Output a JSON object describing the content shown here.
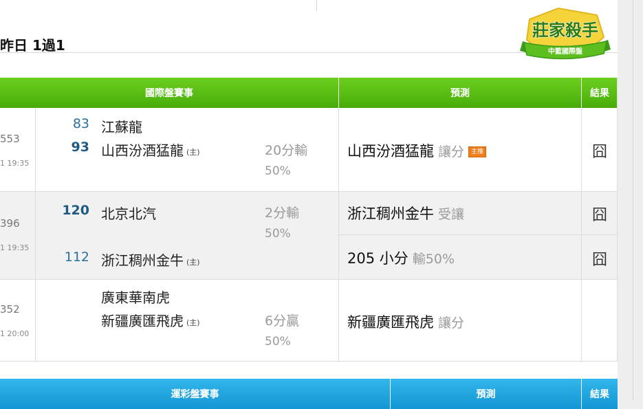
{
  "section_title": "昨日 1過1",
  "logo": {
    "line1": "莊家殺手",
    "line2": "中籃國際盤"
  },
  "intl_table": {
    "headers": {
      "match": "國際盤賽事",
      "prediction": "預測",
      "result": "結果"
    },
    "rows": [
      {
        "game_id": "553",
        "time": "1 19:35",
        "away": {
          "score": "83",
          "team": "江蘇龍"
        },
        "home": {
          "score": "93",
          "team": "山西汾酒猛龍",
          "tag": "(主)"
        },
        "line": "20分輸 50%",
        "predictions": [
          {
            "team": "山西汾酒猛龍",
            "type": "讓分",
            "badge": "主推",
            "result": "囧"
          }
        ]
      },
      {
        "game_id": "396",
        "time": "1 19:35",
        "away": {
          "score": "120",
          "team": "北京北汽"
        },
        "home": {
          "score": "112",
          "team": "浙江稠州金牛",
          "tag": "(主)"
        },
        "line": "2分輸 50%",
        "predictions": [
          {
            "team": "浙江稠州金牛",
            "type": "受讓",
            "result": "囧"
          },
          {
            "team": "205 小分",
            "type": "輸50%",
            "result": "囧"
          }
        ]
      },
      {
        "game_id": "352",
        "time": "1 20:00",
        "away": {
          "score": "",
          "team": "廣東華南虎"
        },
        "home": {
          "score": "",
          "team": "新疆廣匯飛虎",
          "tag": "(主)"
        },
        "line": "6分贏 50%",
        "predictions": [
          {
            "team": "新疆廣匯飛虎",
            "type": "讓分",
            "result": ""
          }
        ]
      }
    ]
  },
  "sports_table": {
    "headers": {
      "match": "運彩盤賽事",
      "prediction": "預測",
      "result": "結果"
    }
  },
  "colors": {
    "green_header": "#47ac0a",
    "blue_header": "#1396d4",
    "badge": "#ee7d1b",
    "score": "#2b6f9e"
  }
}
